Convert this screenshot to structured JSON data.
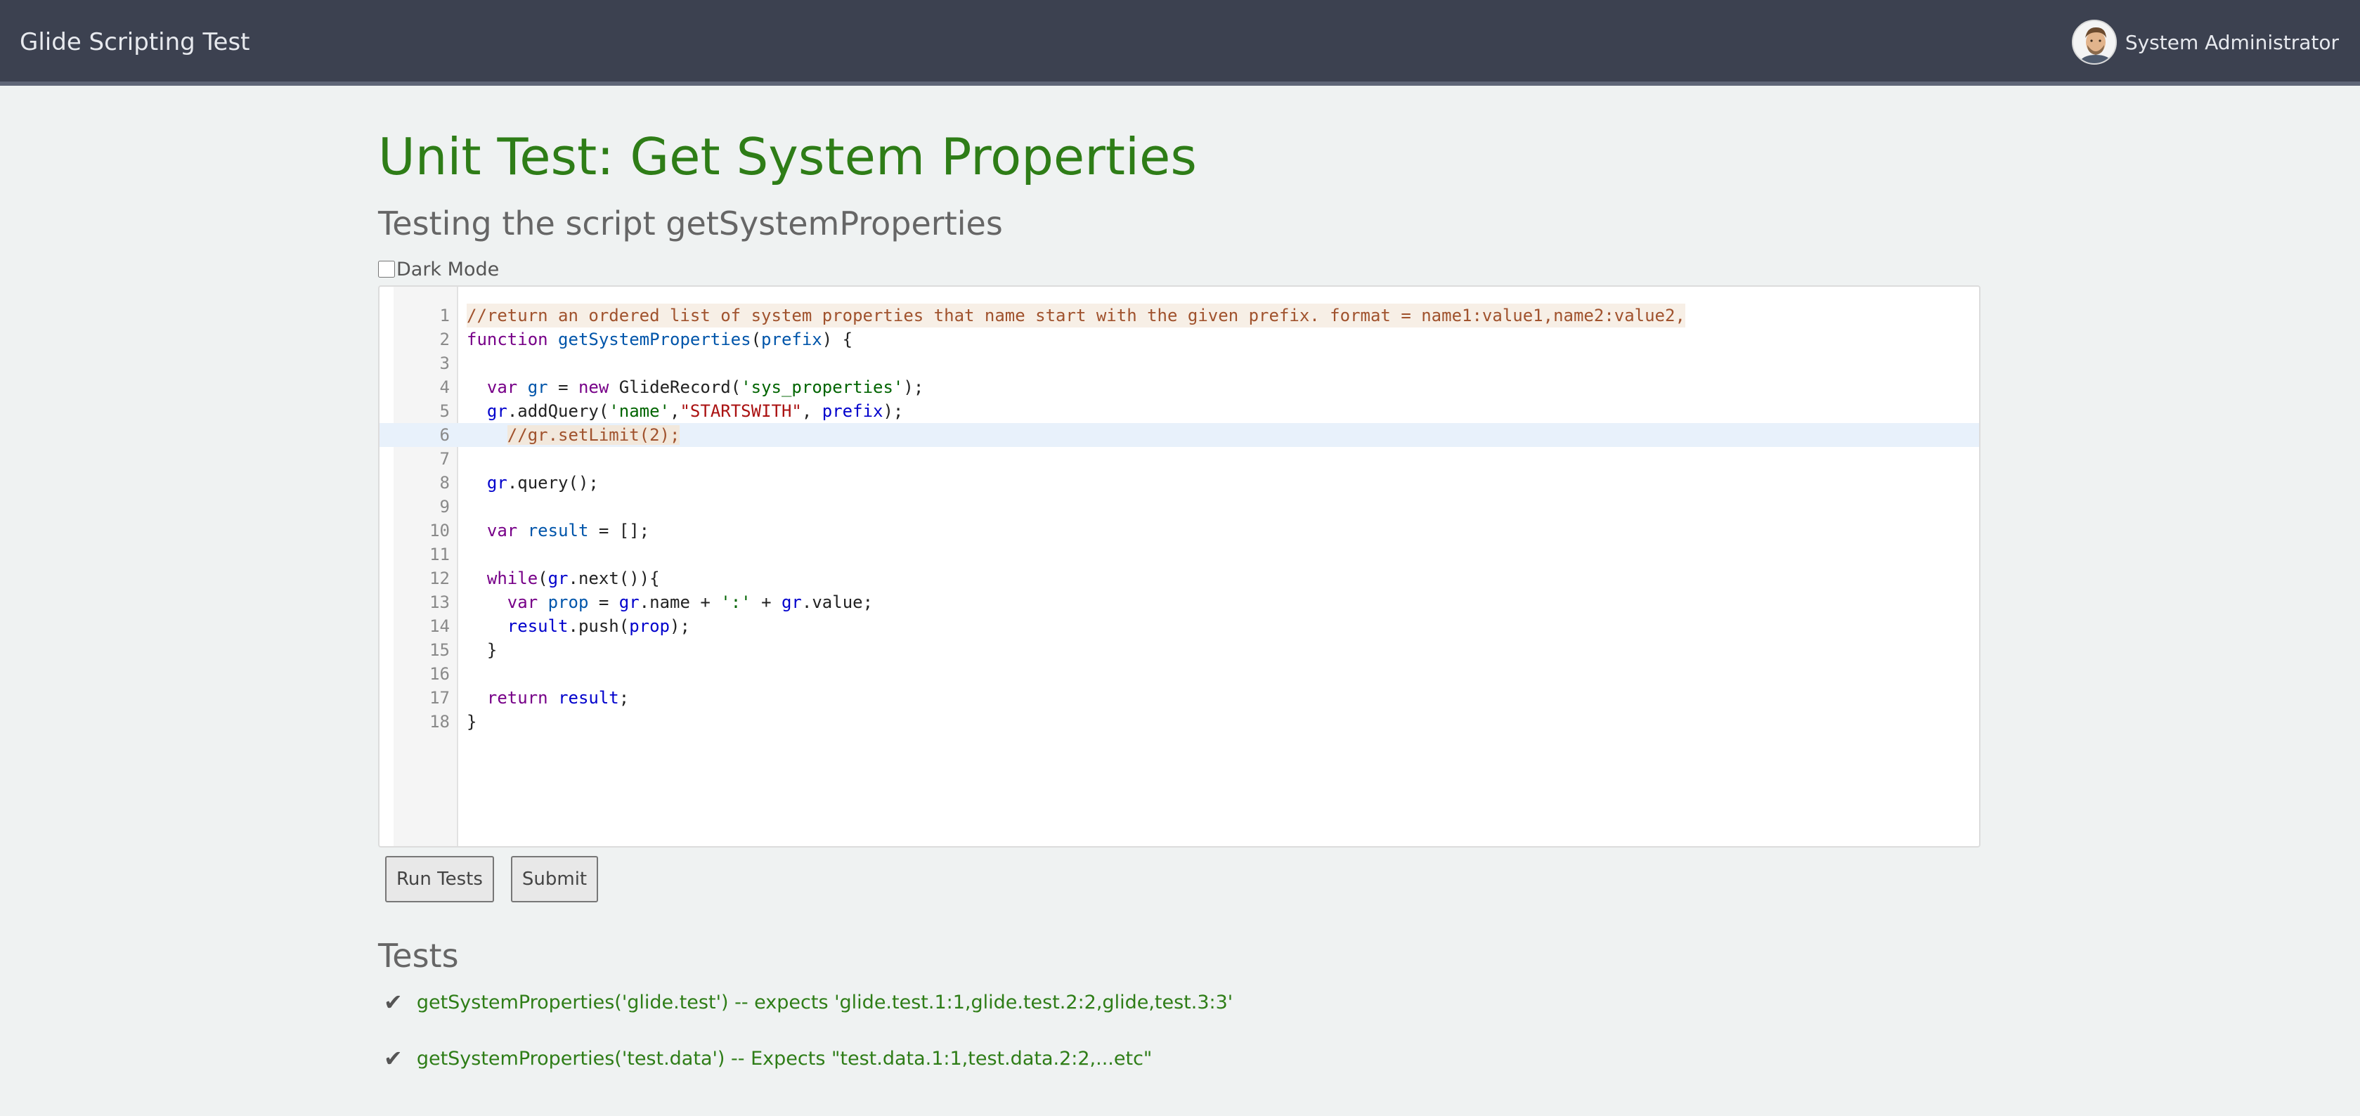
{
  "header": {
    "app_title": "Glide Scripting Test",
    "user_name": "System Administrator"
  },
  "page": {
    "title": "Unit Test: Get System Properties",
    "subtitle": "Testing the script getSystemProperties",
    "dark_mode_label": "Dark Mode",
    "dark_mode_checked": false
  },
  "editor": {
    "active_line": 6,
    "lines": [
      {
        "n": "1",
        "tokens": [
          [
            "c",
            "//return an ordered list of system properties that name start with the given prefix. format = name1:value1,name2:value2,"
          ]
        ]
      },
      {
        "n": "2",
        "tokens": [
          [
            "k",
            "function"
          ],
          [
            "",
            " "
          ],
          [
            "d",
            "getSystemProperties"
          ],
          [
            "",
            "("
          ],
          [
            "d",
            "prefix"
          ],
          [
            "",
            ") {"
          ]
        ]
      },
      {
        "n": "3",
        "tokens": []
      },
      {
        "n": "4",
        "tokens": [
          [
            "",
            "  "
          ],
          [
            "k",
            "var"
          ],
          [
            "",
            " "
          ],
          [
            "d",
            "gr"
          ],
          [
            "",
            " = "
          ],
          [
            "k",
            "new"
          ],
          [
            "",
            " GlideRecord("
          ],
          [
            "s",
            "'sys_properties'"
          ],
          [
            "",
            ");"
          ]
        ]
      },
      {
        "n": "5",
        "tokens": [
          [
            "",
            "  "
          ],
          [
            "v",
            "gr"
          ],
          [
            "",
            ".addQuery("
          ],
          [
            "s",
            "'name'"
          ],
          [
            "",
            ","
          ],
          [
            "s2",
            "\"STARTSWITH\""
          ],
          [
            "",
            ", "
          ],
          [
            "v",
            "prefix"
          ],
          [
            "",
            ");"
          ]
        ]
      },
      {
        "n": "6",
        "tokens": [
          [
            "",
            "    "
          ],
          [
            "c",
            "//gr.setLimit(2);"
          ]
        ]
      },
      {
        "n": "7",
        "tokens": []
      },
      {
        "n": "8",
        "tokens": [
          [
            "",
            "  "
          ],
          [
            "v",
            "gr"
          ],
          [
            "",
            ".query();"
          ]
        ]
      },
      {
        "n": "9",
        "tokens": []
      },
      {
        "n": "10",
        "tokens": [
          [
            "",
            "  "
          ],
          [
            "k",
            "var"
          ],
          [
            "",
            " "
          ],
          [
            "d",
            "result"
          ],
          [
            "",
            " = [];"
          ]
        ]
      },
      {
        "n": "11",
        "tokens": []
      },
      {
        "n": "12",
        "tokens": [
          [
            "",
            "  "
          ],
          [
            "k",
            "while"
          ],
          [
            "",
            "("
          ],
          [
            "v",
            "gr"
          ],
          [
            "",
            ".next()){"
          ]
        ]
      },
      {
        "n": "13",
        "tokens": [
          [
            "",
            "    "
          ],
          [
            "k",
            "var"
          ],
          [
            "",
            " "
          ],
          [
            "d",
            "prop"
          ],
          [
            "",
            " = "
          ],
          [
            "v",
            "gr"
          ],
          [
            "",
            ".name + "
          ],
          [
            "s",
            "':'"
          ],
          [
            "",
            " + "
          ],
          [
            "v",
            "gr"
          ],
          [
            "",
            ".value;"
          ]
        ]
      },
      {
        "n": "14",
        "tokens": [
          [
            "",
            "    "
          ],
          [
            "v",
            "result"
          ],
          [
            "",
            ".push("
          ],
          [
            "v",
            "prop"
          ],
          [
            "",
            ");"
          ]
        ]
      },
      {
        "n": "15",
        "tokens": [
          [
            "",
            "  }"
          ]
        ]
      },
      {
        "n": "16",
        "tokens": []
      },
      {
        "n": "17",
        "tokens": [
          [
            "",
            "  "
          ],
          [
            "k",
            "return"
          ],
          [
            "",
            " "
          ],
          [
            "v",
            "result"
          ],
          [
            "",
            ";"
          ]
        ]
      },
      {
        "n": "18",
        "tokens": [
          [
            "",
            "}"
          ]
        ]
      }
    ]
  },
  "actions": {
    "run_tests_label": "Run Tests",
    "submit_label": "Submit"
  },
  "tests": {
    "heading": "Tests",
    "check_icon": "✔",
    "items": [
      {
        "text": "getSystemProperties('glide.test') -- expects 'glide.test.1:1,glide.test.2:2,glide,test.3:3'"
      },
      {
        "text": "getSystemProperties('test.data') -- Expects \"test.data.1:1,test.data.2:2,...etc\""
      }
    ]
  }
}
